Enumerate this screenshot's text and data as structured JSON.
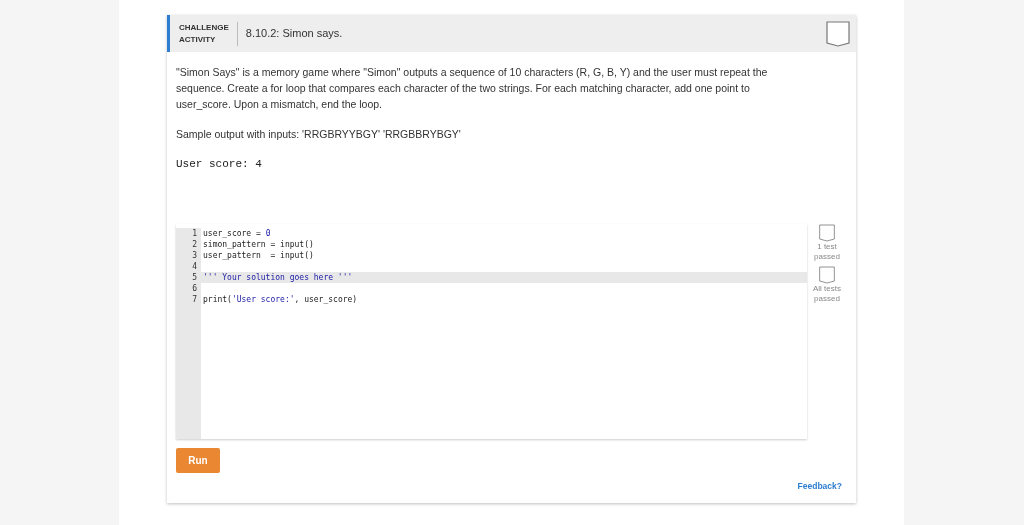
{
  "header": {
    "label_lines": [
      "CHALLENGE",
      "ACTIVITY"
    ],
    "title": "8.10.2: Simon says.",
    "completed": false
  },
  "instructions": "\"Simon Says\" is a memory game where \"Simon\" outputs a sequence of 10 characters (R, G, B, Y) and the user must repeat the sequence. Create a for loop that compares each character of the two strings. For each matching character, add one point to user_score. Upon a mismatch, end the loop.",
  "sample_label": "Sample output with inputs: 'RRGBRYYBGY' 'RRGBBRYBGY'",
  "sample_output": "User score: 4",
  "code_lines": [
    {
      "number": "1",
      "selected": false,
      "segments": [
        {
          "kind": "plain",
          "text": "user_score = "
        },
        {
          "kind": "literal",
          "text": "0"
        }
      ]
    },
    {
      "number": "2",
      "selected": false,
      "segments": [
        {
          "kind": "plain",
          "text": "simon_pattern = input()"
        }
      ]
    },
    {
      "number": "3",
      "selected": false,
      "segments": [
        {
          "kind": "plain",
          "text": "user_pattern  = input()"
        }
      ]
    },
    {
      "number": "4",
      "selected": false
    },
    {
      "number": "5",
      "selected": true,
      "segments": [
        {
          "kind": "literal",
          "text": "''' Your solution goes here '''"
        }
      ]
    },
    {
      "number": "6",
      "selected": false
    },
    {
      "number": "7",
      "selected": false,
      "segments": [
        {
          "kind": "plain",
          "text": "print("
        },
        {
          "kind": "literal",
          "text": "'User score:'"
        },
        {
          "kind": "plain",
          "text": ", user_score)"
        }
      ]
    }
  ],
  "tests": [
    {
      "label": "1 test passed",
      "passed": false
    },
    {
      "label": "All tests passed",
      "passed": false
    }
  ],
  "run_button": "Run",
  "feedback_link": "Feedback?"
}
